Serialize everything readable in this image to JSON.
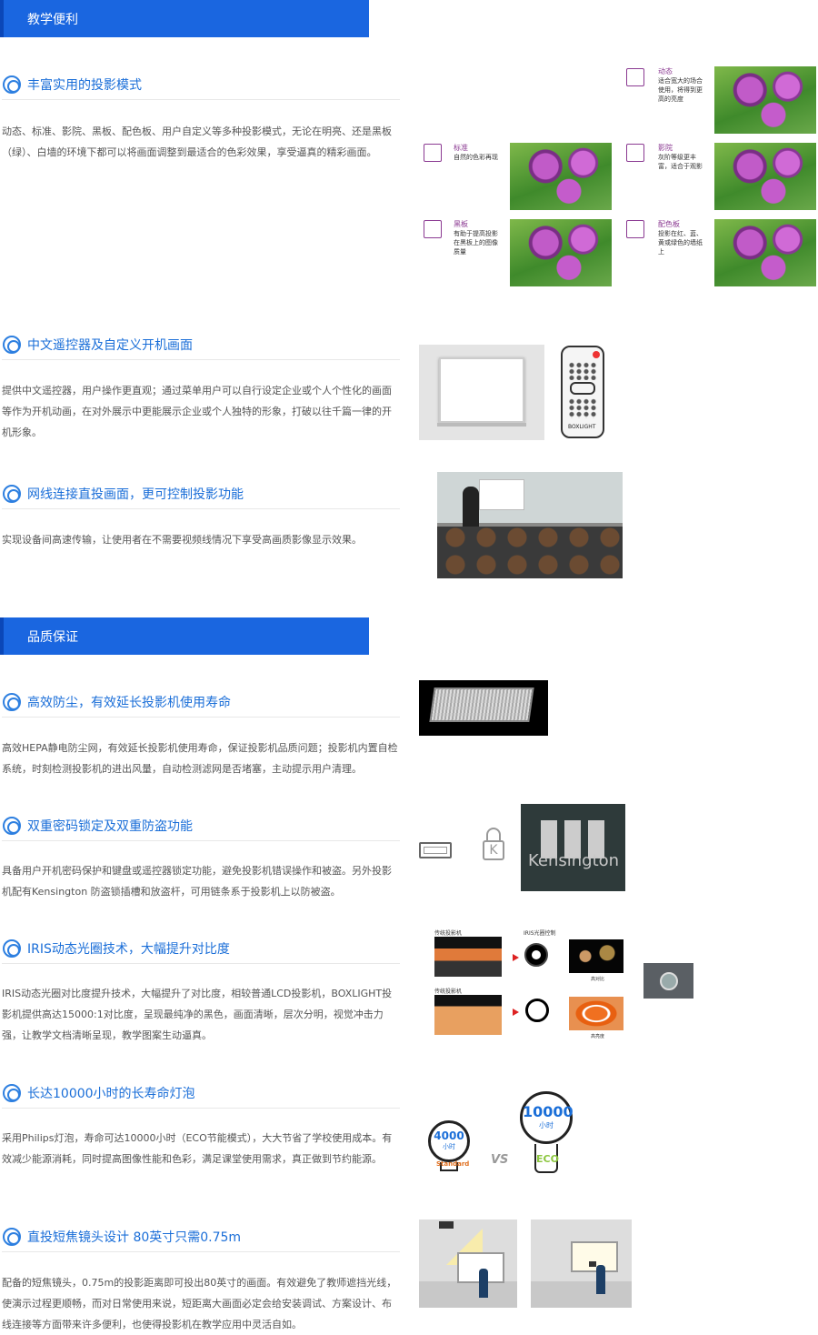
{
  "bands": {
    "teaching": "教学便利",
    "quality": "品质保证"
  },
  "sections": [
    {
      "title": "丰富实用的投影模式",
      "text": "动态、标准、影院、黑板、配色板、用户自定义等多种投影模式，无论在明亮、还是黑板（绿）、白墙的环境下都可以将画面调整到最适合的色彩效果，享受逼真的精彩画面。"
    },
    {
      "title": "中文遥控器及自定义开机画面",
      "text": "提供中文遥控器，用户操作更直观；通过菜单用户可以自行设定企业或个人个性化的画面等作为开机动画，在对外展示中更能展示企业或个人独特的形象，打破以往千篇一律的开机形象。"
    },
    {
      "title": "网线连接直投画面，更可控制投影功能",
      "text": "实现设备间高速传输，让使用者在不需要视频线情况下享受高画质影像显示效果。"
    },
    {
      "title": "高效防尘，有效延长投影机使用寿命",
      "text": "高效HEPA静电防尘网，有效延长投影机使用寿命，保证投影机品质问题；投影机内置自检系统，时刻检测投影机的进出风量，自动检测滤网是否堵塞，主动提示用户清理。"
    },
    {
      "title": "双重密码锁定及双重防盗功能",
      "text": "具备用户开机密码保护和键盘或遥控器锁定功能，避免投影机错误操作和被盗。另外投影机配有Kensington 防盗锁插槽和放盗杆，可用链条系于投影机上以防被盗。"
    },
    {
      "title": "IRIS动态光圈技术，大幅提升对比度",
      "text": "IRIS动态光圈对比度提升技术，大幅提升了对比度，相较普通LCD投影机，BOXLIGHT投影机提供高达15000:1对比度，呈现最纯净的黑色，画面清晰，层次分明，视觉冲击力强，让教学文档清晰呈现，教学图案生动逼真。"
    },
    {
      "title": "长达10000小时的长寿命灯泡",
      "text": "采用Philips灯泡，寿命可达10000小时（ECO节能模式），大大节省了学校使用成本。有效减少能源消耗，同时提高图像性能和色彩，满足课堂使用需求，真正做到节约能源。"
    },
    {
      "title": "直投短焦镜头设计 80英寸只需0.75m",
      "text": "配备的短焦镜头，0.75m的投影距离即可投出80英寸的画面。有效避免了教师遮挡光线，使演示过程更顺畅，而对日常使用来说，短距离大画面必定会给安装调试、方案设计、布线连接等方面带来许多便利，也使得投影机在教学应用中灵活自如。"
    }
  ],
  "modes": [
    {
      "name": "动态",
      "icon_label": "动态",
      "desc": "适合宽大的场合使用，将得到更高的亮度"
    },
    {
      "name": "标准",
      "icon_label": "标准",
      "desc": "自然的色彩再现"
    },
    {
      "name": "影院",
      "icon_label": "影院",
      "desc": "灰阶等级更丰富，适合于观影"
    },
    {
      "name": "黑板",
      "icon_label": "黑板",
      "desc": "有助于提高投影在黑板上的图像质量"
    },
    {
      "name": "配色板",
      "icon_label": "配色",
      "desc": "投影在红、蓝、黄或绿色的墙纸上"
    }
  ],
  "remote_brand": "BOXLIGHT",
  "lock_brand": "Kensington",
  "iris": {
    "label_normal": "传统投影机",
    "label_iris": "IRIS光圈控制",
    "label_high": "高对比",
    "label_low": "高亮度"
  },
  "lamp": {
    "standard_hours": "4000",
    "standard_unit": "小时",
    "standard_label": "Standard",
    "vs": "VS",
    "eco_hours": "10000",
    "eco_unit": "小时",
    "eco_label": "ECO"
  },
  "colors": {
    "accent": "#1a66e0",
    "title": "#1a6ed8",
    "mode": "#8b3a92"
  }
}
